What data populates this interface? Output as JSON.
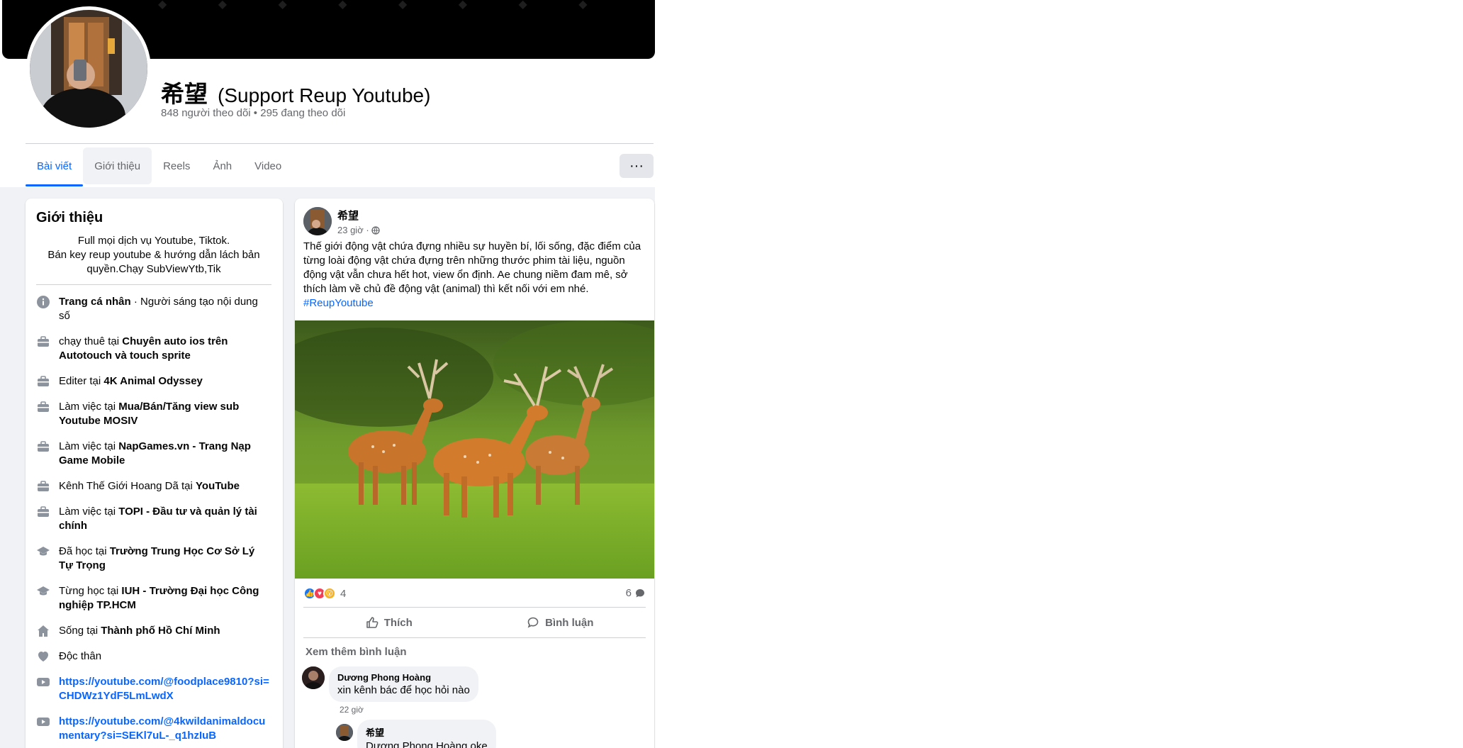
{
  "profile": {
    "name": "希望",
    "subtitle": "(Support Reup Youtube)",
    "stats": "848 người theo dõi • 295 đang theo dõi"
  },
  "tabs": [
    "Bài viết",
    "Giới thiệu",
    "Reels",
    "Ảnh",
    "Video"
  ],
  "more_label": "···",
  "intro": {
    "title": "Giới thiệu",
    "bio": [
      "Full mọi dịch vụ Youtube, Tiktok.",
      "Bán key reup youtube & hướng dẫn lách bản quyền.Chạy SubViewYtb,Tik"
    ],
    "items": [
      {
        "icon": "info-icon",
        "pre": "",
        "bold": "Trang cá nhân",
        "post": " · Người sáng tạo nội dung số"
      },
      {
        "icon": "briefcase-icon",
        "pre": "chạy thuê tại ",
        "bold": "Chuyên auto ios trên Autotouch và touch sprite",
        "post": ""
      },
      {
        "icon": "briefcase-icon",
        "pre": "Editer tại ",
        "bold": "4K Animal Odyssey",
        "post": ""
      },
      {
        "icon": "briefcase-icon",
        "pre": "Làm việc tại ",
        "bold": "Mua/Bán/Tăng view sub Youtube MOSIV",
        "post": ""
      },
      {
        "icon": "briefcase-icon",
        "pre": "Làm việc tại ",
        "bold": "NapGames.vn - Trang Nạp Game Mobile",
        "post": ""
      },
      {
        "icon": "briefcase-icon",
        "pre": "Kênh Thế Giới Hoang Dã tại ",
        "bold": "YouTube",
        "post": ""
      },
      {
        "icon": "briefcase-icon",
        "pre": "Làm việc tại ",
        "bold": "TOPI - Đầu tư và quản lý tài chính",
        "post": ""
      },
      {
        "icon": "graduation-cap-icon",
        "pre": "Đã học tại ",
        "bold": "Trường Trung Học Cơ Sở Lý Tự Trọng",
        "post": ""
      },
      {
        "icon": "graduation-cap-icon",
        "pre": "Từng học tại ",
        "bold": "IUH - Trường Đại học Công nghiệp TP.HCM",
        "post": ""
      },
      {
        "icon": "home-icon",
        "pre": "Sống tại ",
        "bold": "Thành phố Hồ Chí Minh",
        "post": ""
      },
      {
        "icon": "heart-icon",
        "pre": "Độc thân",
        "bold": "",
        "post": ""
      }
    ],
    "links": [
      "https://youtube.com/@foodplace9810?si=CHDWz1YdF5LmLwdX",
      "https://youtube.com/@4kwildanimaldocumentary?si=SEKl7uL-_q1hzIuB"
    ]
  },
  "post": {
    "author": "希望",
    "time": "23 giờ ·",
    "text": "Thế giới động vật chứa đựng nhiều sự huyền bí, lối sống, đặc điểm của từng loài động vật chứa đựng trên những thước phim tài liệu, nguồn động vật vẫn chưa hết hot, view ổn định. Ae chung niềm đam mê, sở thích làm về chủ đề động vật (animal) thì kết nối với em nhé.",
    "hashtag": "#ReupYoutube",
    "reaction_count": "4",
    "comment_count": "6",
    "like_label": "Thích",
    "comment_label": "Bình luận",
    "view_more": "Xem thêm bình luận",
    "comments": [
      {
        "name": "Dương Phong Hoàng",
        "text": "xin kênh bác để học hỏi nào",
        "time": "22 giờ"
      },
      {
        "name": "希望",
        "text": "Dương Phong Hoàng oke"
      }
    ]
  },
  "colors": {
    "accent": "#0866ff",
    "muted": "#65676b",
    "page_bg": "#f0f2f5"
  }
}
